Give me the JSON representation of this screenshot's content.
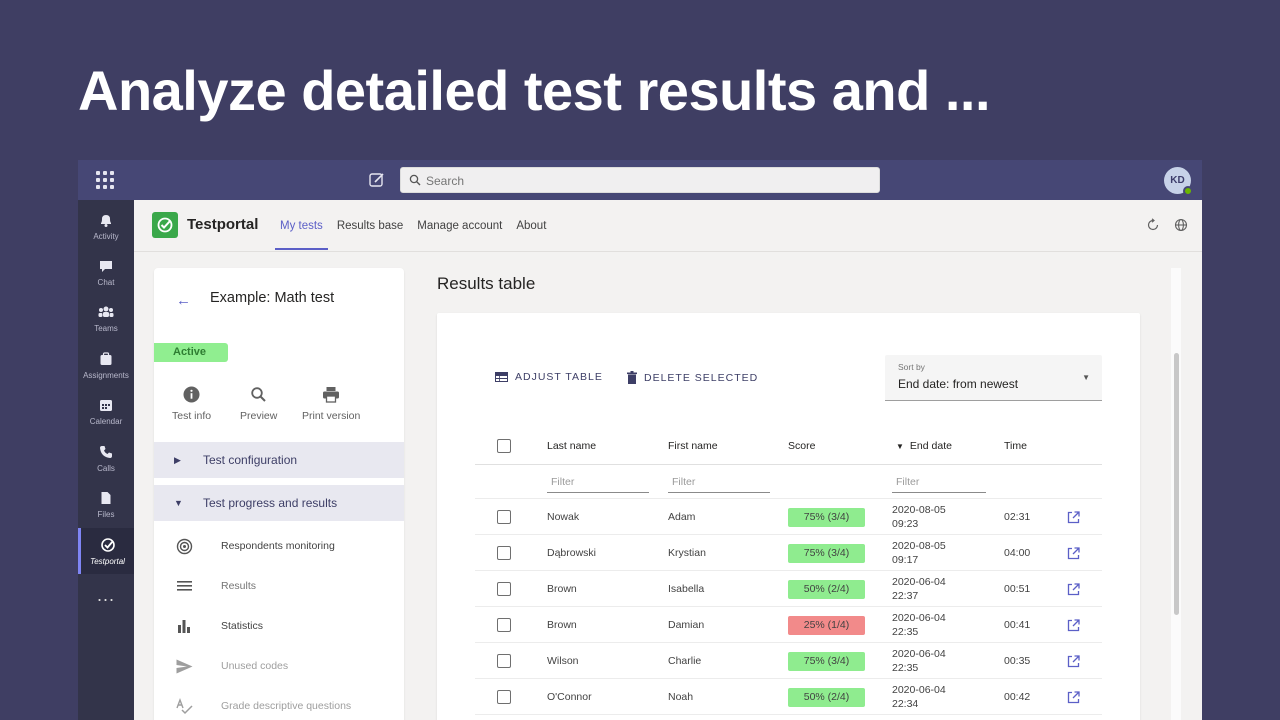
{
  "headline": "Analyze detailed test results and ...",
  "topbar": {
    "search_placeholder": "Search",
    "avatar_initials": "KD"
  },
  "rail": {
    "items": [
      {
        "label": "Activity"
      },
      {
        "label": "Chat"
      },
      {
        "label": "Teams"
      },
      {
        "label": "Assignments"
      },
      {
        "label": "Calendar"
      },
      {
        "label": "Calls"
      },
      {
        "label": "Files"
      },
      {
        "label": "Testportal"
      }
    ],
    "more": "..."
  },
  "app": {
    "name": "Testportal",
    "nav": [
      "My tests",
      "Results base",
      "Manage account",
      "About"
    ],
    "active_nav": "My tests"
  },
  "panel": {
    "title": "Example: Math test",
    "status": "Active",
    "quick_actions": [
      "Test info",
      "Preview",
      "Print version"
    ],
    "sections": [
      "Test configuration",
      "Test progress and results"
    ],
    "subitems": [
      {
        "label": "Respondents monitoring"
      },
      {
        "label": "Results"
      },
      {
        "label": "Statistics"
      },
      {
        "label": "Unused codes"
      },
      {
        "label": "Grade descriptive questions"
      }
    ]
  },
  "main": {
    "title": "Results table",
    "adjust_table": "ADJUST TABLE",
    "delete_selected": "DELETE SELECTED",
    "sort_caption": "Sort by",
    "sort_value": "End date: from newest",
    "columns": [
      "Last name",
      "First name",
      "Score",
      "End date",
      "Time"
    ],
    "filter_placeholder": "Filter",
    "rows": [
      {
        "last": "Nowak",
        "first": "Adam",
        "score": "75% (3/4)",
        "status": "pass",
        "date": "2020-08-05",
        "time_of_day": "09:23",
        "time": "02:31"
      },
      {
        "last": "Dąbrowski",
        "first": "Krystian",
        "score": "75% (3/4)",
        "status": "pass",
        "date": "2020-08-05",
        "time_of_day": "09:17",
        "time": "04:00"
      },
      {
        "last": "Brown",
        "first": "Isabella",
        "score": "50% (2/4)",
        "status": "pass",
        "date": "2020-06-04",
        "time_of_day": "22:37",
        "time": "00:51"
      },
      {
        "last": "Brown",
        "first": "Damian",
        "score": "25% (1/4)",
        "status": "fail",
        "date": "2020-06-04",
        "time_of_day": "22:35",
        "time": "00:41"
      },
      {
        "last": "Wilson",
        "first": "Charlie",
        "score": "75% (3/4)",
        "status": "pass",
        "date": "2020-06-04",
        "time_of_day": "22:35",
        "time": "00:35"
      },
      {
        "last": "O'Connor",
        "first": "Noah",
        "score": "50% (2/4)",
        "status": "pass",
        "date": "2020-06-04",
        "time_of_day": "22:34",
        "time": "00:42"
      }
    ]
  },
  "colors": {
    "background": "#3f3e63",
    "teams_bar": "#464775",
    "accent": "#5b5fc7",
    "pass": "#8fec8f",
    "fail": "#f28a8a",
    "brand_green": "#3aa84a"
  }
}
